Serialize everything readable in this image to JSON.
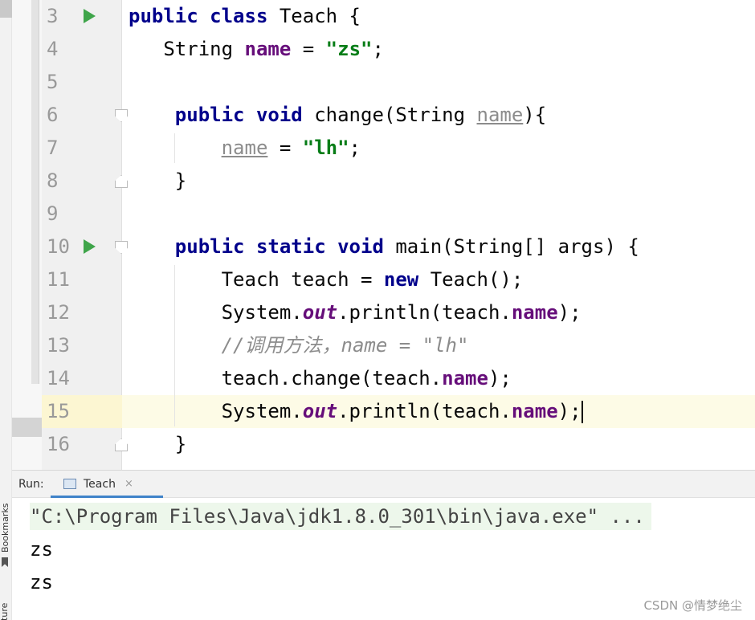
{
  "side_strip": {
    "bookmarks_label": "Bookmarks",
    "structure_label": "cture"
  },
  "editor": {
    "lines": [
      {
        "num": "3",
        "run": true,
        "fold": "",
        "indent": "",
        "tokens": [
          {
            "t": "public",
            "c": "kw"
          },
          {
            "t": " ",
            "c": ""
          },
          {
            "t": "class",
            "c": "kw"
          },
          {
            "t": " Teach {",
            "c": ""
          }
        ]
      },
      {
        "num": "4",
        "run": false,
        "fold": "",
        "indent": "   ",
        "tokens": [
          {
            "t": "String ",
            "c": ""
          },
          {
            "t": "name",
            "c": "fld"
          },
          {
            "t": " = ",
            "c": ""
          },
          {
            "t": "\"zs\"",
            "c": "str"
          },
          {
            "t": ";",
            "c": ""
          }
        ]
      },
      {
        "num": "5",
        "run": false,
        "fold": "",
        "indent": "",
        "tokens": []
      },
      {
        "num": "6",
        "run": false,
        "fold": "open",
        "indent": "    ",
        "tokens": [
          {
            "t": "public",
            "c": "kw"
          },
          {
            "t": " ",
            "c": ""
          },
          {
            "t": "void",
            "c": "kw"
          },
          {
            "t": " change(String ",
            "c": ""
          },
          {
            "t": "name",
            "c": "unused"
          },
          {
            "t": "){",
            "c": ""
          }
        ]
      },
      {
        "num": "7",
        "run": false,
        "fold": "",
        "indent": "        ",
        "tokens": [
          {
            "t": "name",
            "c": "unused"
          },
          {
            "t": " = ",
            "c": ""
          },
          {
            "t": "\"lh\"",
            "c": "str"
          },
          {
            "t": ";",
            "c": ""
          }
        ]
      },
      {
        "num": "8",
        "run": false,
        "fold": "close",
        "indent": "    ",
        "tokens": [
          {
            "t": "}",
            "c": ""
          }
        ]
      },
      {
        "num": "9",
        "run": false,
        "fold": "",
        "indent": "",
        "tokens": []
      },
      {
        "num": "10",
        "run": true,
        "fold": "open",
        "indent": "    ",
        "tokens": [
          {
            "t": "public",
            "c": "kw"
          },
          {
            "t": " ",
            "c": ""
          },
          {
            "t": "static",
            "c": "kw"
          },
          {
            "t": " ",
            "c": ""
          },
          {
            "t": "void",
            "c": "kw"
          },
          {
            "t": " main(String[] args) {",
            "c": ""
          }
        ]
      },
      {
        "num": "11",
        "run": false,
        "fold": "",
        "indent": "        ",
        "tokens": [
          {
            "t": "Teach teach = ",
            "c": ""
          },
          {
            "t": "new",
            "c": "kw"
          },
          {
            "t": " Teach();",
            "c": ""
          }
        ]
      },
      {
        "num": "12",
        "run": false,
        "fold": "",
        "indent": "        ",
        "tokens": [
          {
            "t": "System.",
            "c": ""
          },
          {
            "t": "out",
            "c": "sfld"
          },
          {
            "t": ".println(teach.",
            "c": ""
          },
          {
            "t": "name",
            "c": "fld"
          },
          {
            "t": ");",
            "c": ""
          }
        ]
      },
      {
        "num": "13",
        "run": false,
        "fold": "",
        "indent": "        ",
        "tokens": [
          {
            "t": "//调用方法，name = \"lh\"",
            "c": "cmt"
          }
        ]
      },
      {
        "num": "14",
        "run": false,
        "fold": "",
        "indent": "        ",
        "tokens": [
          {
            "t": "teach.change(teach.",
            "c": ""
          },
          {
            "t": "name",
            "c": "fld"
          },
          {
            "t": ");",
            "c": ""
          }
        ]
      },
      {
        "num": "15",
        "run": false,
        "fold": "",
        "indent": "        ",
        "current": true,
        "tokens": [
          {
            "t": "System.",
            "c": ""
          },
          {
            "t": "out",
            "c": "sfld"
          },
          {
            "t": ".println(teach.",
            "c": ""
          },
          {
            "t": "name",
            "c": "fld"
          },
          {
            "t": ");",
            "c": ""
          }
        ]
      },
      {
        "num": "16",
        "run": false,
        "fold": "close",
        "indent": "    ",
        "tokens": [
          {
            "t": "}",
            "c": ""
          }
        ]
      }
    ]
  },
  "run_panel": {
    "label": "Run:",
    "tab_label": "Teach",
    "tab_close": "×",
    "output": [
      "\"C:\\Program Files\\Java\\jdk1.8.0_301\\bin\\java.exe\" ...",
      "zs",
      "zs"
    ]
  },
  "watermark": "CSDN @情梦绝尘",
  "colors": {
    "keyword": "#00008b",
    "field": "#660e7a",
    "string": "#067d17",
    "comment": "#8c8c8c",
    "run_icon": "#3fa54a",
    "current_line": "#fdfbe6",
    "tab_underline": "#4083c9"
  }
}
